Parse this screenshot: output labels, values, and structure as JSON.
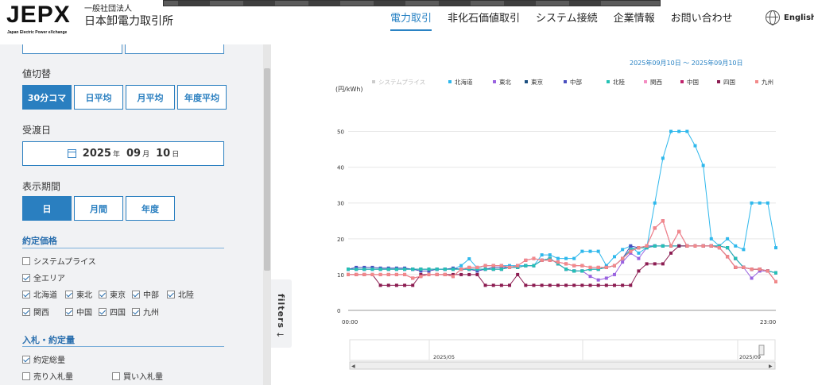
{
  "header": {
    "logo_text": "JEPX",
    "logo_sub": "Japan Electric Power eXchange",
    "org_small": "一般社団法人",
    "org_name": "日本卸電力取引所",
    "nav": [
      {
        "label": "電力取引",
        "active": true
      },
      {
        "label": "非化石価値取引",
        "active": false
      },
      {
        "label": "システム接続",
        "active": false
      },
      {
        "label": "企業情報",
        "active": false
      },
      {
        "label": "お問い合わせ",
        "active": false
      }
    ],
    "lang": "English"
  },
  "sidebar": {
    "switch_label": "値切替",
    "switch_buttons": [
      {
        "label": "30分コマ",
        "selected": true
      },
      {
        "label": "日平均",
        "selected": false
      },
      {
        "label": "月平均",
        "selected": false
      },
      {
        "label": "年度平均",
        "selected": false
      }
    ],
    "delivery_label": "受渡日",
    "date": {
      "year": "2025",
      "year_unit": "年",
      "month": "09",
      "month_unit": "月",
      "day": "10",
      "day_unit": "日"
    },
    "period_label": "表示期間",
    "period_buttons": [
      {
        "label": "日",
        "selected": true
      },
      {
        "label": "月間",
        "selected": false
      },
      {
        "label": "年度",
        "selected": false
      }
    ],
    "price_section": "約定価格",
    "price_checks": [
      {
        "label": "システムプライス",
        "checked": false
      },
      {
        "label": "全エリア",
        "checked": true
      }
    ],
    "area_checks": [
      {
        "label": "北海道",
        "checked": true
      },
      {
        "label": "東北",
        "checked": true
      },
      {
        "label": "東京",
        "checked": true
      },
      {
        "label": "中部",
        "checked": true
      },
      {
        "label": "北陸",
        "checked": true
      },
      {
        "label": "関西",
        "checked": true
      },
      {
        "label": "中国",
        "checked": true
      },
      {
        "label": "四国",
        "checked": true
      },
      {
        "label": "九州",
        "checked": true
      }
    ],
    "volume_section": "入札・約定量",
    "volume_checks": [
      {
        "label": "約定総量",
        "checked": true
      },
      {
        "label": "売り入札量",
        "checked": false
      },
      {
        "label": "買い入札量",
        "checked": false
      }
    ],
    "filters_label": "filters",
    "filters_arrow": "←"
  },
  "chart_meta": {
    "date_range": "2025年09月10日 ～ 2025年09月10日",
    "navigator_labels": [
      "2025/05",
      "2025/09"
    ]
  },
  "chart_data": {
    "type": "line",
    "ylabel": "(円/kWh)",
    "ylim": [
      0,
      55
    ],
    "yticks": [
      0,
      10,
      20,
      30,
      40,
      50
    ],
    "xtick_labels": [
      "00:00",
      "23:00"
    ],
    "legend_position": "top",
    "series": [
      {
        "name": "システムプライス",
        "color": "#cccccc",
        "visible": false,
        "values": []
      },
      {
        "name": "北海道",
        "color": "#2fb8ec",
        "values": [
          11.5,
          11.5,
          11.5,
          11.5,
          11.5,
          11.5,
          11.5,
          11.5,
          11.5,
          11.5,
          11.5,
          11.5,
          11.5,
          11.5,
          12.5,
          14.4,
          11.8,
          12.5,
          12.5,
          12.5,
          12.5,
          12.5,
          12.5,
          12.5,
          15.5,
          15.5,
          14.5,
          14.5,
          14.5,
          16.5,
          16.5,
          16.5,
          12.5,
          15.0,
          17.0,
          18.0,
          16.0,
          17.5,
          30.0,
          42.5,
          50.0,
          50.0,
          50.0,
          46.0,
          40.5,
          20.0,
          18.0,
          20.0,
          18.0,
          17.0,
          30.0,
          30.0,
          30.0,
          17.5
        ]
      },
      {
        "name": "東北",
        "color": "#9a63e0",
        "values": [
          11.5,
          11.5,
          11.5,
          11.5,
          11.5,
          11.5,
          11.5,
          11.5,
          11.5,
          11.5,
          11.5,
          11.5,
          11.5,
          11.5,
          11.5,
          11.5,
          11.5,
          11.5,
          11.5,
          11.5,
          12.0,
          12.0,
          12.5,
          12.5,
          14.0,
          14.5,
          13.0,
          11.5,
          11.0,
          11.0,
          9.5,
          8.5,
          9.0,
          10.0,
          13.5,
          16.0,
          14.5,
          17.5,
          18.0,
          18.0,
          18.0,
          18.0,
          18.0,
          18.0,
          18.0,
          18.0,
          18.0,
          17.5,
          14.5,
          12.0,
          9.0,
          11.0,
          11.0,
          10.5
        ]
      },
      {
        "name": "東京",
        "color": "#1c4f80",
        "values": [
          11.5,
          11.5,
          11.5,
          11.5,
          11.5,
          11.5,
          11.5,
          11.5,
          11.5,
          11.5,
          11.5,
          11.5,
          11.5,
          11.5,
          11.5,
          11.5,
          11.5,
          11.5,
          11.5,
          11.5,
          12.0,
          12.0,
          12.5,
          12.5,
          14.0,
          14.5,
          13.0,
          11.5,
          11.0,
          11.0,
          11.5,
          11.5,
          12.0,
          12.5,
          14.5,
          17.0,
          17.5,
          17.5,
          18.0,
          18.0,
          18.0,
          18.0,
          18.0,
          18.0,
          18.0,
          18.0,
          18.0,
          17.5,
          14.5,
          12.0,
          11.5,
          11.5,
          11.0,
          10.5
        ]
      },
      {
        "name": "中部",
        "color": "#4a4fbf",
        "values": [
          11.5,
          12.0,
          12.0,
          12.0,
          11.8,
          11.8,
          11.8,
          11.8,
          11.5,
          11.0,
          11.0,
          11.5,
          11.5,
          11.8,
          11.5,
          11.5,
          11.0,
          11.5,
          12.0,
          12.0,
          12.0,
          12.0,
          12.5,
          12.5,
          14.0,
          14.5,
          13.0,
          11.5,
          11.0,
          11.0,
          11.5,
          11.5,
          12.0,
          12.5,
          14.5,
          18.0,
          17.5,
          18.0,
          18.0,
          18.0,
          18.0,
          18.0,
          18.0,
          18.0,
          18.0,
          18.0,
          18.0,
          17.5,
          14.5,
          12.0,
          11.5,
          11.5,
          11.0,
          10.5
        ]
      },
      {
        "name": "北陸",
        "color": "#25c2b5",
        "values": [
          11.5,
          11.5,
          11.5,
          11.5,
          11.5,
          11.5,
          11.5,
          11.5,
          11.5,
          11.5,
          11.5,
          11.5,
          11.5,
          11.5,
          11.5,
          11.5,
          11.5,
          11.5,
          11.5,
          11.5,
          12.0,
          12.0,
          12.5,
          12.5,
          14.0,
          14.5,
          13.0,
          11.5,
          11.0,
          11.0,
          11.5,
          11.5,
          12.0,
          12.5,
          14.5,
          17.0,
          17.5,
          17.5,
          18.0,
          18.0,
          18.0,
          18.0,
          18.0,
          18.0,
          18.0,
          18.0,
          18.0,
          17.5,
          14.5,
          12.0,
          11.5,
          11.5,
          11.0,
          10.5
        ]
      },
      {
        "name": "関西",
        "color": "#f48ec3",
        "values": [
          10.0,
          10.0,
          10.0,
          10.0,
          10.0,
          10.0,
          10.0,
          10.0,
          9.0,
          9.5,
          10.0,
          10.0,
          10.0,
          9.5,
          11.5,
          12.0,
          12.0,
          12.5,
          12.5,
          12.5,
          12.0,
          12.5,
          14.0,
          14.5,
          14.0,
          14.0,
          13.5,
          13.0,
          12.5,
          12.5,
          12.0,
          12.0,
          12.0,
          12.5,
          14.5,
          16.5,
          17.5,
          18.0,
          23.0,
          25.0,
          18.0,
          22.0,
          18.0,
          18.0,
          18.0,
          18.0,
          17.5,
          15.0,
          12.0,
          12.0,
          11.5,
          11.5,
          11.0,
          8.0
        ]
      },
      {
        "name": "中国",
        "color": "#c0246d",
        "values": [
          10.0,
          10.0,
          10.0,
          10.0,
          10.0,
          10.0,
          10.0,
          10.0,
          9.0,
          9.5,
          10.0,
          10.0,
          10.0,
          9.5,
          11.5,
          12.0,
          12.0,
          12.5,
          12.5,
          12.5,
          12.0,
          12.5,
          14.0,
          14.5,
          14.0,
          14.0,
          13.5,
          13.0,
          12.5,
          12.5,
          12.0,
          12.0,
          12.0,
          12.5,
          14.5,
          16.5,
          17.5,
          18.0,
          23.0,
          25.0,
          18.0,
          22.0,
          18.0,
          18.0,
          18.0,
          18.0,
          17.5,
          15.0,
          12.0,
          12.0,
          11.5,
          11.5,
          11.0,
          8.0
        ]
      },
      {
        "name": "四国",
        "color": "#8c1d52",
        "values": [
          10.0,
          10.0,
          10.0,
          10.0,
          7.0,
          7.0,
          7.0,
          7.0,
          7.0,
          10.0,
          10.0,
          10.0,
          10.0,
          10.0,
          10.0,
          10.0,
          10.0,
          7.0,
          7.0,
          7.0,
          7.0,
          10.0,
          7.0,
          7.0,
          7.0,
          7.0,
          7.0,
          7.0,
          7.0,
          7.0,
          7.0,
          7.0,
          7.0,
          7.0,
          7.0,
          7.0,
          11.0,
          13.0,
          13.0,
          13.0,
          16.0,
          18.0,
          18.0,
          18.0,
          18.0,
          18.0,
          17.5,
          15.0,
          12.0,
          12.0,
          11.5,
          11.5,
          11.0,
          8.0
        ]
      },
      {
        "name": "九州",
        "color": "#f28a8a",
        "values": [
          10.0,
          10.0,
          10.0,
          10.0,
          10.0,
          10.0,
          10.0,
          10.0,
          9.0,
          9.5,
          10.0,
          10.0,
          10.0,
          9.5,
          11.5,
          12.0,
          12.0,
          12.5,
          12.5,
          12.5,
          12.0,
          12.5,
          14.0,
          14.5,
          14.0,
          14.0,
          13.5,
          13.0,
          12.5,
          12.5,
          12.0,
          12.0,
          12.0,
          12.5,
          14.5,
          16.5,
          17.5,
          18.0,
          23.0,
          25.0,
          18.0,
          22.0,
          18.0,
          18.0,
          18.0,
          18.0,
          17.5,
          15.0,
          12.0,
          12.0,
          11.5,
          11.5,
          11.0,
          8.0
        ]
      }
    ]
  }
}
